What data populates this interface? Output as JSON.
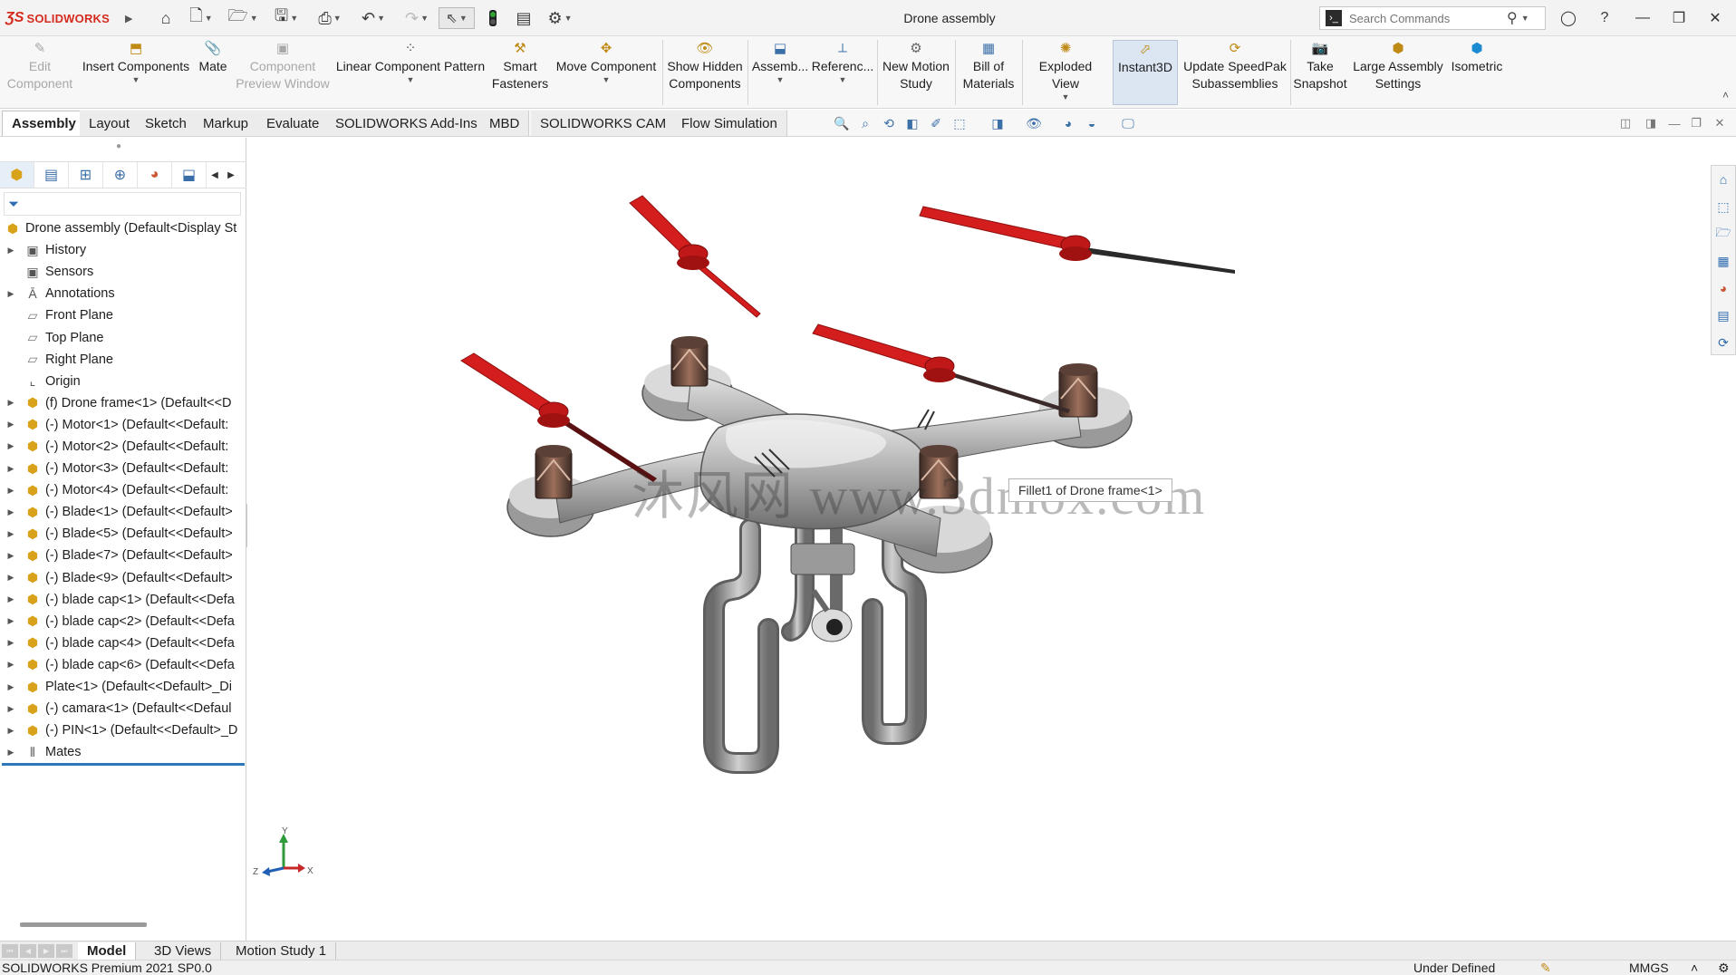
{
  "app": {
    "brand": "SOLIDWORKS",
    "document_title": "Drone assembly",
    "search_placeholder": "Search Commands"
  },
  "command_manager": [
    {
      "label": "Edit\nComponent",
      "icon": "edit-component-icon",
      "disabled": true
    },
    {
      "label": "Insert Components",
      "icon": "insert-components-icon"
    },
    {
      "label": "Mate",
      "icon": "mate-icon"
    },
    {
      "label": "Component\nPreview Window",
      "icon": "preview-window-icon",
      "disabled": true
    },
    {
      "label": "Linear Component Pattern",
      "icon": "linear-pattern-icon"
    },
    {
      "label": "Smart\nFasteners",
      "icon": "smart-fasteners-icon"
    },
    {
      "label": "Move Component",
      "icon": "move-component-icon"
    },
    {
      "label": "Show Hidden\nComponents",
      "icon": "show-hidden-icon"
    },
    {
      "label": "Assemb...",
      "icon": "assembly-features-icon"
    },
    {
      "label": "Referenc...",
      "icon": "reference-geometry-icon"
    },
    {
      "label": "New Motion\nStudy",
      "icon": "motion-study-icon"
    },
    {
      "label": "Bill of\nMaterials",
      "icon": "bom-icon"
    },
    {
      "label": "Exploded View",
      "icon": "exploded-view-icon"
    },
    {
      "label": "Instant3D",
      "icon": "instant3d-icon",
      "active": true
    },
    {
      "label": "Update SpeedPak\nSubassemblies",
      "icon": "speedpak-icon"
    },
    {
      "label": "Take\nSnapshot",
      "icon": "camera-icon"
    },
    {
      "label": "Large Assembly\nSettings",
      "icon": "large-assembly-icon"
    },
    {
      "label": "Isometric",
      "icon": "isometric-cube-icon"
    }
  ],
  "tabs": [
    "Assembly",
    "Layout",
    "Sketch",
    "Markup",
    "Evaluate",
    "SOLIDWORKS Add-Ins",
    "MBD",
    "SOLIDWORKS CAM",
    "Flow Simulation"
  ],
  "active_tab": "Assembly",
  "feature_tree": [
    {
      "label": "Drone assembly  (Default<Display St",
      "icon": "assembly-icon",
      "root": true
    },
    {
      "label": "History",
      "icon": "history-folder-icon",
      "expandable": true
    },
    {
      "label": "Sensors",
      "icon": "sensor-folder-icon"
    },
    {
      "label": "Annotations",
      "icon": "annotations-folder-icon",
      "expandable": true
    },
    {
      "label": "Front Plane",
      "icon": "plane-icon"
    },
    {
      "label": "Top Plane",
      "icon": "plane-icon"
    },
    {
      "label": "Right Plane",
      "icon": "plane-icon"
    },
    {
      "label": "Origin",
      "icon": "origin-icon"
    },
    {
      "label": "(f) Drone frame<1> (Default<<D",
      "icon": "part-icon",
      "expandable": true
    },
    {
      "label": "(-) Motor<1> (Default<<Default:",
      "icon": "part-icon",
      "expandable": true
    },
    {
      "label": "(-) Motor<2> (Default<<Default:",
      "icon": "part-icon",
      "expandable": true
    },
    {
      "label": "(-) Motor<3> (Default<<Default:",
      "icon": "part-icon",
      "expandable": true
    },
    {
      "label": "(-) Motor<4> (Default<<Default:",
      "icon": "part-icon",
      "expandable": true
    },
    {
      "label": "(-) Blade<1> (Default<<Default>",
      "icon": "part-icon",
      "expandable": true
    },
    {
      "label": "(-) Blade<5> (Default<<Default>",
      "icon": "part-icon",
      "expandable": true
    },
    {
      "label": "(-) Blade<7> (Default<<Default>",
      "icon": "part-icon",
      "expandable": true
    },
    {
      "label": "(-) Blade<9> (Default<<Default>",
      "icon": "part-icon",
      "expandable": true
    },
    {
      "label": "(-) blade cap<1> (Default<<Defa",
      "icon": "part-icon",
      "expandable": true
    },
    {
      "label": "(-) blade cap<2> (Default<<Defa",
      "icon": "part-icon",
      "expandable": true
    },
    {
      "label": "(-) blade cap<4> (Default<<Defa",
      "icon": "part-icon",
      "expandable": true
    },
    {
      "label": "(-) blade cap<6> (Default<<Defa",
      "icon": "part-icon",
      "expandable": true
    },
    {
      "label": "Plate<1> (Default<<Default>_Di",
      "icon": "part-icon",
      "expandable": true
    },
    {
      "label": "(-) camara<1> (Default<<Defaul",
      "icon": "part-icon",
      "expandable": true
    },
    {
      "label": "(-) PIN<1> (Default<<Default>_D",
      "icon": "part-icon",
      "expandable": true
    },
    {
      "label": "Mates",
      "icon": "mates-icon",
      "expandable": true
    }
  ],
  "viewport": {
    "tooltip": "Fillet1 of Drone frame<1>",
    "watermark": "沐风网 www.3dmox.com",
    "triad": {
      "x": "X",
      "y": "Y",
      "z": "Z"
    },
    "colors": {
      "blade": "#d41e1e",
      "body": "#a8a8a8",
      "motor": "#5a4036"
    }
  },
  "bottom_tabs": [
    "Model",
    "3D Views",
    "Motion Study 1"
  ],
  "active_bottom_tab": "Model",
  "status": {
    "product": "SOLIDWORKS Premium 2021 SP0.0",
    "state": "Under Defined",
    "units": "MMGS",
    "units_arrow": "˄"
  }
}
